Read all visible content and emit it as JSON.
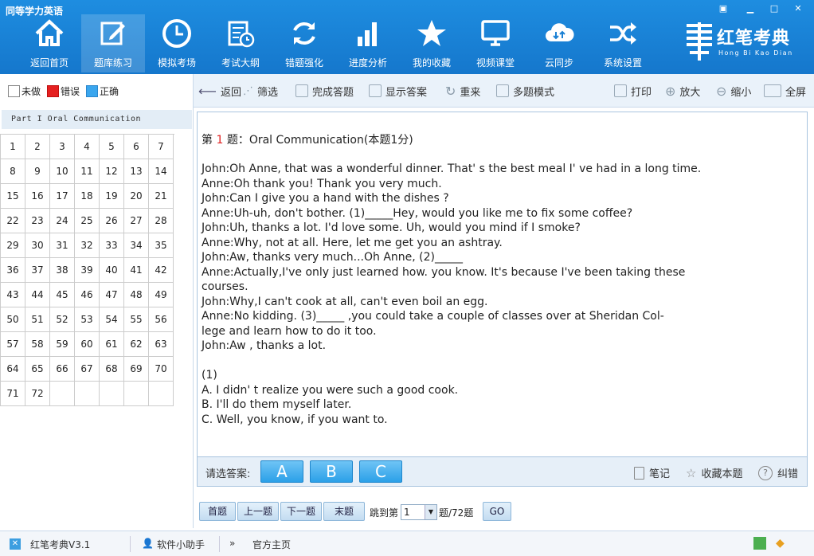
{
  "app": {
    "title": "同等学力英语"
  },
  "nav": [
    {
      "label": "返回首页",
      "icon": "home-icon"
    },
    {
      "label": "题库练习",
      "icon": "edit-icon"
    },
    {
      "label": "模拟考场",
      "icon": "clock-icon"
    },
    {
      "label": "考试大纲",
      "icon": "syllabus-icon"
    },
    {
      "label": "错题强化",
      "icon": "refresh-icon"
    },
    {
      "label": "进度分析",
      "icon": "bar-chart-icon"
    },
    {
      "label": "我的收藏",
      "icon": "star-icon"
    },
    {
      "label": "视频课堂",
      "icon": "monitor-icon"
    },
    {
      "label": "云同步",
      "icon": "cloud-icon"
    },
    {
      "label": "系统设置",
      "icon": "shuffle-icon"
    }
  ],
  "logo": {
    "cn": "红笔考典",
    "pinyin": "Hong Bi Kao Dian"
  },
  "legend": {
    "unanswered": "未做",
    "wrong": "错误",
    "correct": "正确",
    "unanswered_color": "#ffffff",
    "wrong_color": "#e52020",
    "correct_color": "#3aa6ee"
  },
  "part_label": "Part I Oral Communication",
  "questions": [
    "1",
    "2",
    "3",
    "4",
    "5",
    "6",
    "7",
    "8",
    "9",
    "10",
    "11",
    "12",
    "13",
    "14",
    "15",
    "16",
    "17",
    "18",
    "19",
    "20",
    "21",
    "22",
    "23",
    "24",
    "25",
    "26",
    "27",
    "28",
    "29",
    "30",
    "31",
    "32",
    "33",
    "34",
    "35",
    "36",
    "37",
    "38",
    "39",
    "40",
    "41",
    "42",
    "43",
    "44",
    "45",
    "46",
    "47",
    "48",
    "49",
    "50",
    "51",
    "52",
    "53",
    "54",
    "55",
    "56",
    "57",
    "58",
    "59",
    "60",
    "61",
    "62",
    "63",
    "64",
    "65",
    "66",
    "67",
    "68",
    "69",
    "70",
    "71",
    "72"
  ],
  "toolbar": {
    "back": "返回",
    "filter": "筛选",
    "finish": "完成答题",
    "show_answer": "显示答案",
    "redo": "重来",
    "multi": "多题模式",
    "print": "打印",
    "zoom_in": "放大",
    "zoom_out": "缩小",
    "fullscreen": "全屏"
  },
  "question": {
    "prefix": "第 ",
    "number": "1",
    "suffix": " 题：Oral Communication(本题1分)",
    "body": "John:Oh Anne, that was a wonderful dinner. That' s the best meal I' ve had in a long time.\nAnne:Oh thank you! Thank you very much.\nJohn:Can I give you a hand with the dishes ?\nAnne:Uh-uh, don't bother. (1)_____Hey, would you like me to fix some coffee?\nJohn:Uh, thanks a lot. I'd love some. Uh, would you mind if I smoke?\nAnne:Why, not at all. Here, let me get you an ashtray.\nJohn:Aw, thanks very much...Oh Anne, (2)_____\nAnne:Actually,I've only just learned how. you know. It's because I've been taking these\ncourses.\nJohn:Why,I can't cook at all, can't even boil an egg.\nAnne:No kidding. (3)_____ ,you could take a couple of classes over at Sheridan Col-\nlege and learn how to do it too.\nJohn:Aw , thanks a lot.\n\n(1)\nA. I didn' t realize you were such a good cook.\nB. I'll do them myself later.\nC. Well, you know, if you want to."
  },
  "answer": {
    "label": "请选答案:",
    "options": [
      "A",
      "B",
      "C"
    ],
    "notes": "笔记",
    "favorite": "收藏本题",
    "report": "纠错"
  },
  "pager": {
    "first": "首题",
    "prev": "上一题",
    "next": "下一题",
    "last": "末题",
    "jump_label": "跳到第",
    "jump_value": "1",
    "total": "题/72题",
    "go": "GO"
  },
  "status": {
    "version": "红笔考典V3.1",
    "helper": "软件小助手",
    "official": "官方主页"
  }
}
